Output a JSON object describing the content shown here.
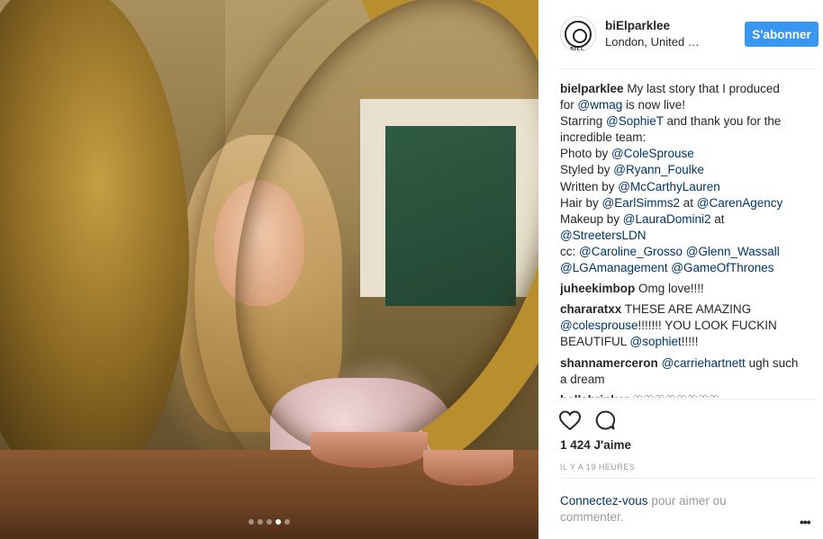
{
  "post": {
    "username": "biElparklee",
    "location": "London, United Kingdom",
    "follow_label": "S'abonner",
    "likes": "1 424 J'aime",
    "time": "IL Y A 19 HEURES",
    "carousel": {
      "count": 5,
      "active_index": 3
    }
  },
  "caption": {
    "user": "bielparklee",
    "lines": [
      [
        {
          "t": "My last story that I produced"
        }
      ],
      [
        {
          "t": "for "
        },
        {
          "m": "@wmag"
        },
        {
          "t": " is now live!"
        }
      ],
      [
        {
          "t": "Starring "
        },
        {
          "m": "@SophieT"
        },
        {
          "t": " and thank you for the"
        }
      ],
      [
        {
          "t": "incredible team:"
        }
      ],
      [
        {
          "t": "Photo by "
        },
        {
          "m": "@ColeSprouse"
        }
      ],
      [
        {
          "t": "Styled by "
        },
        {
          "m": "@Ryann_Foulke"
        }
      ],
      [
        {
          "t": "Written by "
        },
        {
          "m": "@McCarthyLauren"
        }
      ],
      [
        {
          "t": "Hair by "
        },
        {
          "m": "@EarlSimms2"
        },
        {
          "t": " at "
        },
        {
          "m": "@CarenAgency"
        }
      ],
      [
        {
          "t": "Makeup by "
        },
        {
          "m": "@LauraDomini2"
        },
        {
          "t": " at"
        }
      ],
      [
        {
          "m": "@StreetersLDN"
        }
      ],
      [
        {
          "t": "cc: "
        },
        {
          "m": "@Caroline_Grosso"
        },
        {
          "t": " "
        },
        {
          "m": "@Glenn_Wassall"
        }
      ],
      [
        {
          "m": "@LGAmanagement"
        },
        {
          "t": " "
        },
        {
          "m": "@GameOfThrones"
        }
      ]
    ]
  },
  "comments": [
    {
      "user": "juheekimbop",
      "lines": [
        [
          {
            "t": "Omg love!!!!"
          }
        ]
      ]
    },
    {
      "user": "chararatxx",
      "lines": [
        [
          {
            "t": "THESE ARE AMAZING"
          }
        ],
        [
          {
            "m": "@colesprouse"
          },
          {
            "t": "!!!!!!! YOU LOOK FUCKIN"
          }
        ],
        [
          {
            "t": "BEAUTIFUL "
          },
          {
            "m": "@sophiet"
          },
          {
            "t": "!!!!!"
          }
        ]
      ]
    },
    {
      "user": "shannamerceron",
      "lines": [
        [
          {
            "m": "@carriehartnett"
          },
          {
            "t": " ugh such"
          }
        ],
        [
          {
            "t": "a dream"
          }
        ]
      ]
    },
    {
      "user": "bellabrinker",
      "lines": [
        [
          {
            "t": "♡♡♡♡♡♡♡♡"
          }
        ]
      ]
    }
  ],
  "login": {
    "link": "Connectez-vous",
    "text": " pour aimer ou commenter."
  },
  "icons": {
    "heart": "heart-icon",
    "comment": "comment-icon",
    "more": "more-options-icon",
    "avatar": "versace-medusa-logo"
  },
  "colors": {
    "follow_button": "#3897f0",
    "mention": "#003569",
    "muted": "#999999"
  }
}
